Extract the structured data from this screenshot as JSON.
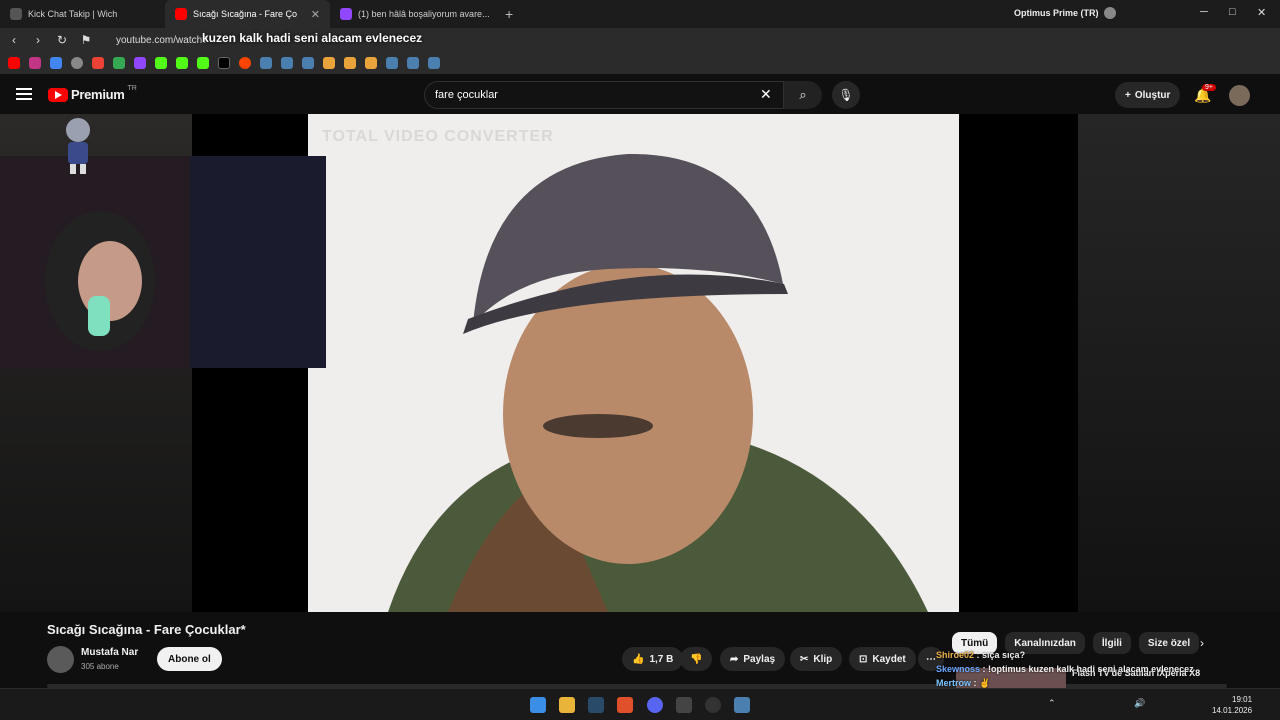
{
  "browser": {
    "tabs": [
      {
        "label": "Kick Chat Takip | Wich"
      },
      {
        "label": "Sıcağı Sıcağına - Fare Ço"
      },
      {
        "label": "(1) ben hâlâ boşaliyorum avare..."
      }
    ],
    "overlay_tab_label": "Skewnoss",
    "profile": "Optimus Prime (TR)",
    "url": "youtube.com/watch?",
    "overlay_message": "kuzen kalk hadi seni alacam evlenecez"
  },
  "youtube": {
    "logo_text": "Premium",
    "logo_region": "TR",
    "search_value": "fare çocuklar",
    "create_label": "Oluştur",
    "notif_badge": "9+"
  },
  "video": {
    "title": "Sıcağı Sıcağına - Fare Çocuklar*",
    "watermark": "TOTAL VIDEO CONVERTER",
    "channel": "Mustafa Nar",
    "subscribers": "305 abone",
    "subscribe_label": "Abone ol",
    "likes": "1,7 B",
    "share_label": "Paylaş",
    "clip_label": "Klip",
    "save_label": "Kaydet"
  },
  "chips": [
    "Tümü",
    "Kanalınızdan",
    "İlgili",
    "Size özel"
  ],
  "chat": [
    {
      "user": "Shiroe02",
      "message": "sıça sıça?"
    },
    {
      "user": "Skewnoss",
      "message": "!optimus kuzen kalk hadi seni alacam evlenecez"
    },
    {
      "user": "Mertrow",
      "message": "✌"
    }
  ],
  "recommendation": {
    "title": "Flash TV'de Satılan iXperia X8"
  },
  "taskbar": {
    "time": "19:01",
    "date": "14.01.2026"
  }
}
